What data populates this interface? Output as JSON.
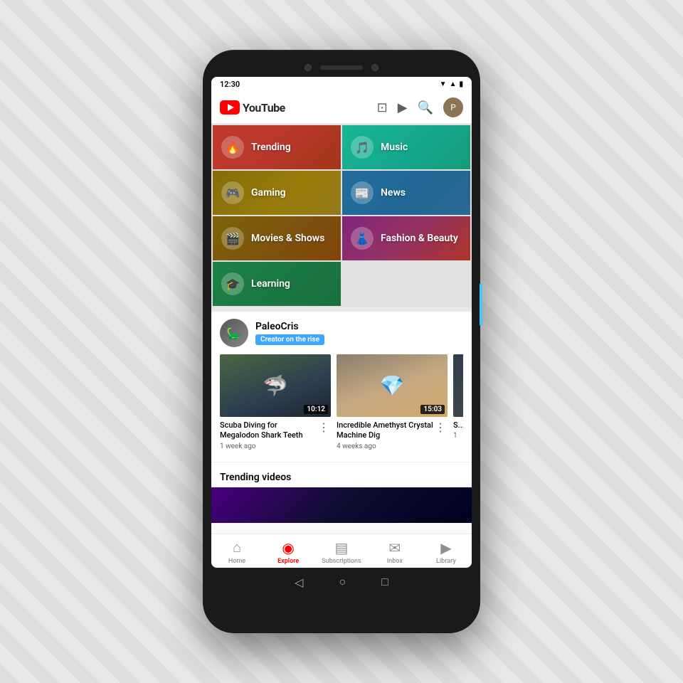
{
  "phone": {
    "status_bar": {
      "time": "12:30",
      "icons": [
        "wifi",
        "signal",
        "battery"
      ]
    },
    "header": {
      "logo_text": "YouTube",
      "cast_icon": "📡",
      "camera_icon": "📷",
      "search_icon": "🔍",
      "avatar_initials": "P"
    },
    "categories": [
      {
        "id": "trending",
        "label": "Trending",
        "icon": "🔥",
        "css_class": "cat-trending"
      },
      {
        "id": "music",
        "label": "Music",
        "icon": "🎵",
        "css_class": "cat-music"
      },
      {
        "id": "gaming",
        "label": "Gaming",
        "icon": "🎮",
        "css_class": "cat-gaming"
      },
      {
        "id": "news",
        "label": "News",
        "icon": "📰",
        "css_class": "cat-news"
      },
      {
        "id": "movies",
        "label": "Movies & Shows",
        "icon": "🎬",
        "css_class": "cat-movies"
      },
      {
        "id": "fashion",
        "label": "Fashion & Beauty",
        "icon": "👗",
        "css_class": "cat-fashion"
      },
      {
        "id": "learning",
        "label": "Learning",
        "icon": "🎓",
        "css_class": "cat-learning"
      }
    ],
    "creator": {
      "name": "PaleoCris",
      "badge": "Creator on the rise",
      "avatar_emoji": "🦕"
    },
    "videos": [
      {
        "id": "v1",
        "title": "Scuba Diving for Megalodon Shark Teeth",
        "duration": "10:12",
        "time_ago": "1 week ago",
        "thumb_class": "video-thumb-1"
      },
      {
        "id": "v2",
        "title": "Incredible Amethyst Crystal Machine Dig",
        "duration": "15:03",
        "time_ago": "4 weeks ago",
        "thumb_class": "video-thumb-2"
      },
      {
        "id": "v3",
        "title": "S...",
        "duration": "",
        "time_ago": "1",
        "thumb_class": "video-thumb-3"
      }
    ],
    "trending_section": {
      "title": "Trending videos"
    },
    "bottom_nav": [
      {
        "id": "home",
        "label": "Home",
        "icon": "⌂",
        "active": false
      },
      {
        "id": "explore",
        "label": "Explore",
        "icon": "◎",
        "active": true
      },
      {
        "id": "subscriptions",
        "label": "Subscriptions",
        "icon": "▤",
        "active": false
      },
      {
        "id": "inbox",
        "label": "Inbox",
        "icon": "✉",
        "active": false
      },
      {
        "id": "library",
        "label": "Library",
        "icon": "▶",
        "active": false
      }
    ]
  }
}
